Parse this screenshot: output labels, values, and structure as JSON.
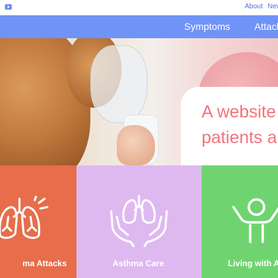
{
  "top_links": {
    "youtube_icon": "youtube-icon",
    "about": "About",
    "news": "New"
  },
  "nav": {
    "items": [
      "Symptoms",
      "Attack"
    ]
  },
  "hero": {
    "headline_line1": "A website",
    "headline_line2": "patients a"
  },
  "tiles": [
    {
      "label": "ma Attacks",
      "icon": "lungs-icon",
      "color": "#e76d4b"
    },
    {
      "label": "Asthma Care",
      "icon": "hands-lungs-icon",
      "color": "#deb9f0"
    },
    {
      "label": "Living with As",
      "icon": "person-arms-raised-icon",
      "color": "#6fd470"
    }
  ],
  "colors": {
    "nav_bar": "#6f93f7",
    "headline": "#f2747c"
  }
}
